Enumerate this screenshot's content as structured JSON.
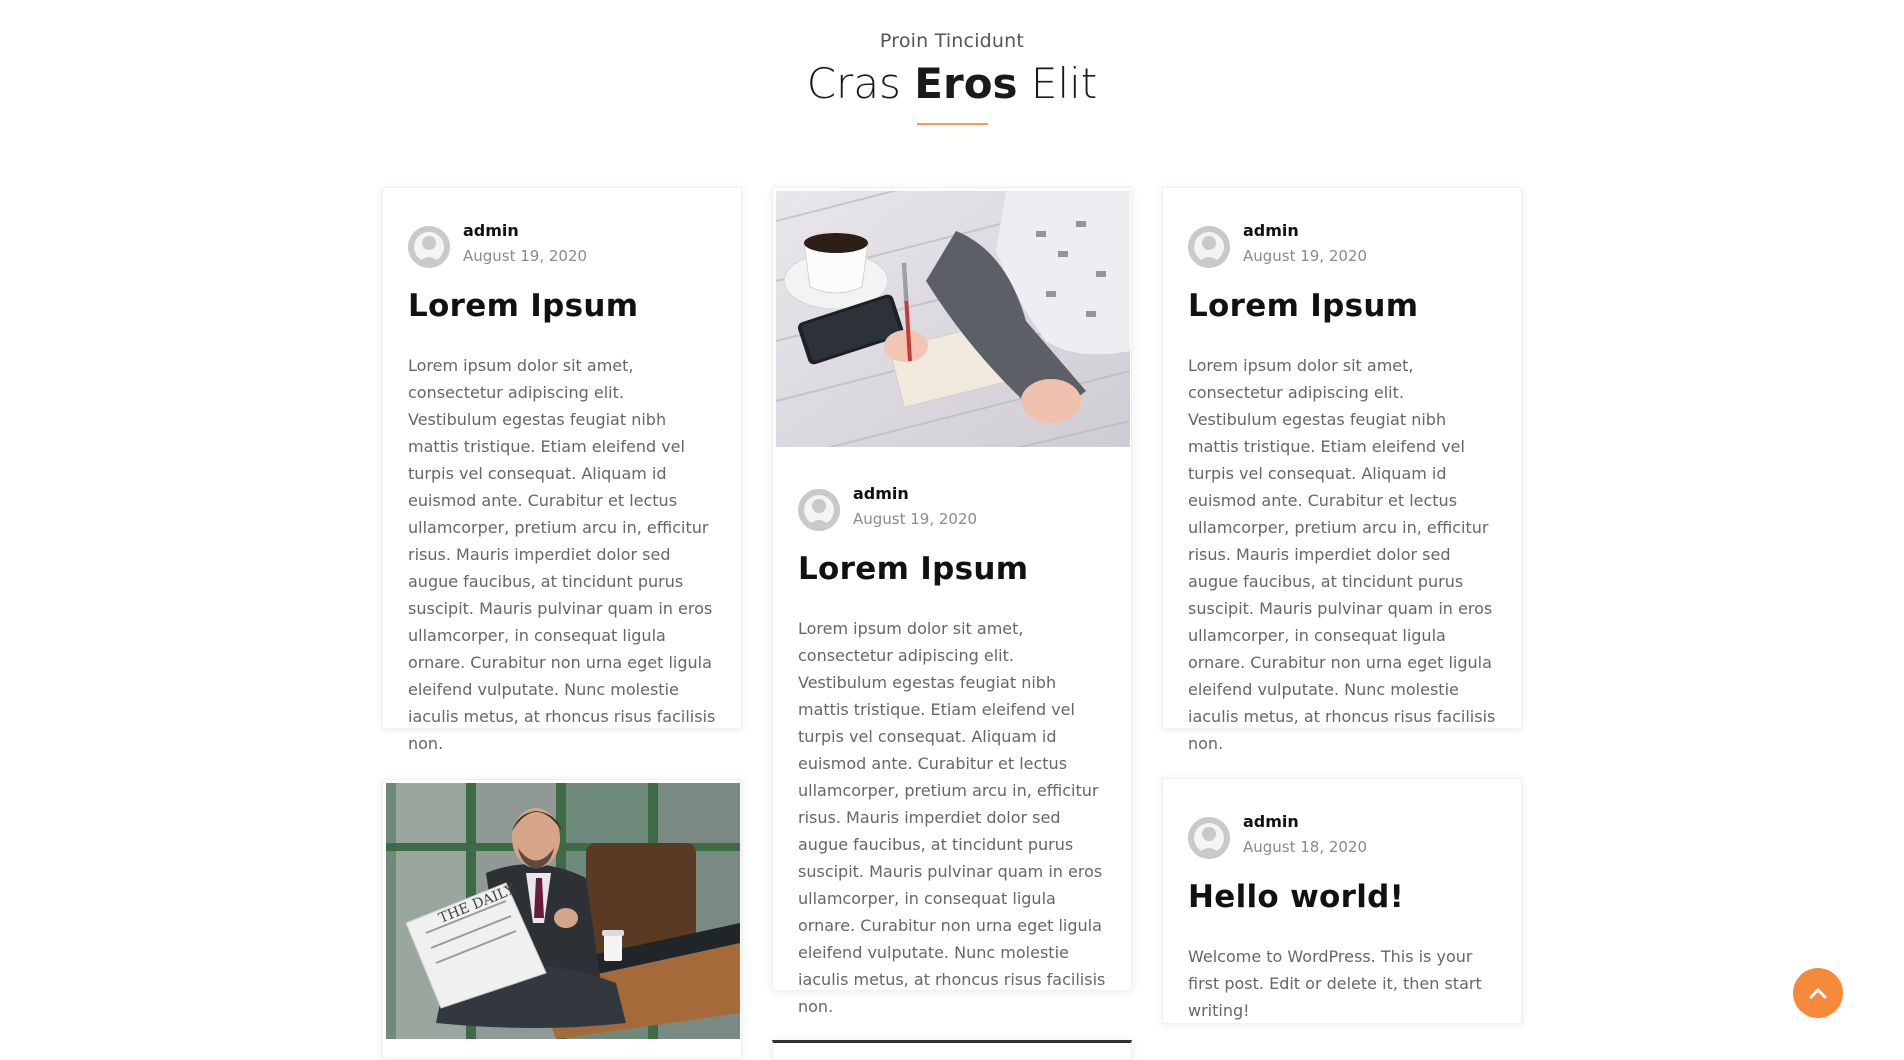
{
  "section": {
    "kicker": "Proin Tincidunt",
    "title_part1": "Cras ",
    "title_bold": "Eros",
    "title_part2": " Elit",
    "accent_color": "#f0a050"
  },
  "lorem_excerpt": "Lorem ipsum dolor sit amet, consectetur adipiscing elit. Vestibulum egestas feugiat nibh mattis tristique. Etiam eleifend vel turpis vel consequat. Aliquam id euismod ante. Curabitur et lectus ullamcorper, pretium arcu in, efficitur risus. Mauris imperdiet dolor sed augue faucibus, at tincidunt purus suscipit. Mauris pulvinar quam in eros ullamcorper, in consequat ligula ornare. Curabitur non urna eget ligula eleifend vulputate. Nunc molestie iaculis metus, at rhoncus risus facilisis non.",
  "posts": [
    {
      "author": "admin",
      "date": "August 19, 2020",
      "title": "Lorem Ipsum",
      "excerpt": "Lorem ipsum dolor sit amet, consectetur adipiscing elit. Vestibulum egestas feugiat nibh mattis tristique. Etiam eleifend vel turpis vel consequat. Aliquam id euismod ante. Curabitur et lectus ullamcorper, pretium arcu in, efficitur risus. Mauris imperdiet dolor sed augue faucibus, at tincidunt purus suscipit. Mauris pulvinar quam in eros ullamcorper, in consequat ligula ornare. Curabitur non urna eget ligula eleifend vulputate. Nunc molestie iaculis metus, at rhoncus risus facilisis non."
    },
    {
      "author": "admin",
      "date": "August 19, 2020",
      "title": "Lorem Ipsum",
      "excerpt": "Lorem ipsum dolor sit amet, consectetur adipiscing elit. Vestibulum egestas feugiat nibh mattis tristique. Etiam eleifend vel turpis vel consequat. Aliquam id euismod ante. Curabitur et lectus ullamcorper, pretium arcu in, efficitur risus. Mauris imperdiet dolor sed augue faucibus, at tincidunt purus suscipit. Mauris pulvinar quam in eros ullamcorper, in consequat ligula ornare. Curabitur non urna eget ligula eleifend vulputate. Nunc molestie iaculis metus, at rhoncus risus facilisis non.",
      "image_icon": "writing-notebook-photo"
    },
    {
      "author": "admin",
      "date": "August 19, 2020",
      "title": "Lorem Ipsum",
      "excerpt": "Lorem ipsum dolor sit amet, consectetur adipiscing elit. Vestibulum egestas feugiat nibh mattis tristique. Etiam eleifend vel turpis vel consequat. Aliquam id euismod ante. Curabitur et lectus ullamcorper, pretium arcu in, efficitur risus. Mauris imperdiet dolor sed augue faucibus, at tincidunt purus suscipit. Mauris pulvinar quam in eros ullamcorper, in consequat ligula ornare. Curabitur non urna eget ligula eleifend vulputate. Nunc molestie iaculis metus, at rhoncus risus facilisis non."
    },
    {
      "image_icon": "man-reading-newspaper-photo"
    },
    {
      "author": "admin",
      "date": "August 18, 2020",
      "title": "Hello world!",
      "excerpt": "Welcome to WordPress. This is your first post. Edit or delete it, then start writing!"
    }
  ],
  "back_to_top": {
    "icon": "chevron-up-icon",
    "color": "#f58a3c"
  }
}
